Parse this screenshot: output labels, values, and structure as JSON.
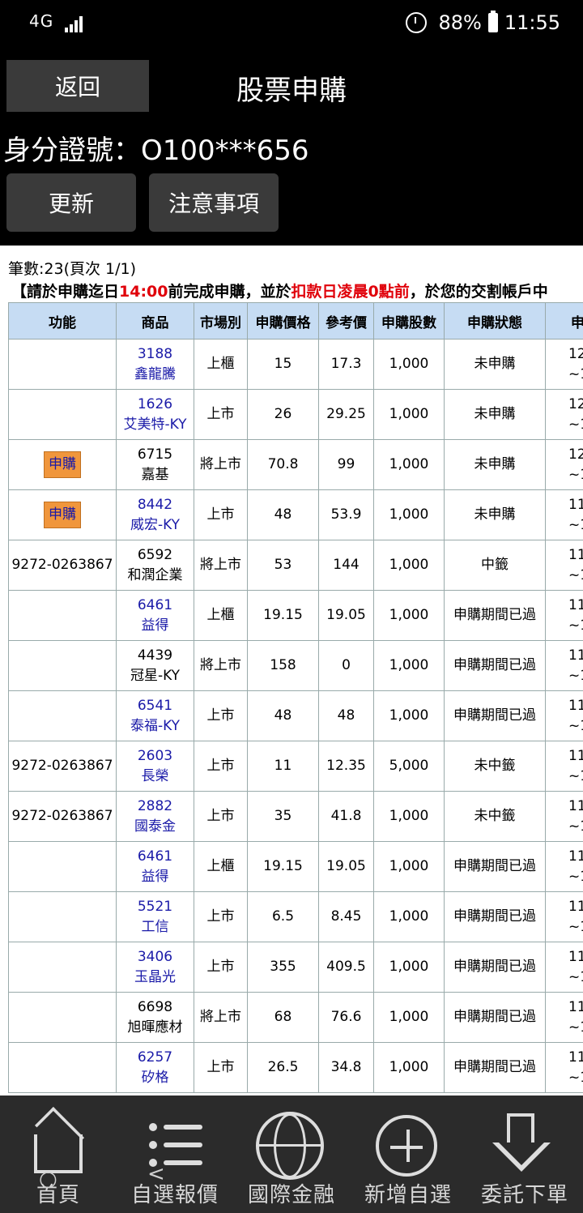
{
  "status_bar": {
    "network": "4G",
    "battery": "88%",
    "time": "11:55"
  },
  "header": {
    "back_label": "返回",
    "title": "股票申購"
  },
  "id_line": "身分證號：O100***656",
  "buttons": {
    "refresh": "更新",
    "notice": "注意事項"
  },
  "count_text": "筆數:23(頁次 1/1)",
  "notice": {
    "p1": "【請於申購迄日",
    "p2": "14:00",
    "p3": "前完成申購，並於",
    "p4": "扣款日凌晨0點前",
    "p5": "，於您的交割帳戶中"
  },
  "colors": {
    "notice_red": "#e0000a",
    "header_blue": "#c6dcf3",
    "apply_orange": "#f0963c"
  },
  "table": {
    "headers": [
      "功能",
      "商品",
      "市場別",
      "申購價格",
      "參考價",
      "申購股數",
      "申購狀態",
      "申購"
    ],
    "rows": [
      {
        "func": "",
        "code": "3188",
        "name": "鑫龍騰",
        "link": true,
        "market": "上櫃",
        "price": "15",
        "ref": "17.3",
        "shares": "1,000",
        "status": "未申購",
        "d1": "12",
        "d2": "~1"
      },
      {
        "func": "",
        "code": "1626",
        "name": "艾美特-KY",
        "link": true,
        "market": "上市",
        "price": "26",
        "ref": "29.25",
        "shares": "1,000",
        "status": "未申購",
        "d1": "12",
        "d2": "~1"
      },
      {
        "func": "申購",
        "code": "6715",
        "name": "嘉基",
        "link": false,
        "market": "將上市",
        "price": "70.8",
        "ref": "99",
        "shares": "1,000",
        "status": "未申購",
        "d1": "12",
        "d2": "~1"
      },
      {
        "func": "申購",
        "code": "8442",
        "name": "威宏-KY",
        "link": true,
        "market": "上市",
        "price": "48",
        "ref": "53.9",
        "shares": "1,000",
        "status": "未申購",
        "d1": "11",
        "d2": "~1"
      },
      {
        "func": "9272-0263867",
        "code": "6592",
        "name": "和潤企業",
        "link": false,
        "market": "將上市",
        "price": "53",
        "ref": "144",
        "shares": "1,000",
        "status": "中籤",
        "d1": "11",
        "d2": "~1"
      },
      {
        "func": "",
        "code": "6461",
        "name": "益得",
        "link": true,
        "market": "上櫃",
        "price": "19.15",
        "ref": "19.05",
        "shares": "1,000",
        "status": "申購期間已過",
        "d1": "11",
        "d2": "~1"
      },
      {
        "func": "",
        "code": "4439",
        "name": "冠星-KY",
        "link": false,
        "market": "將上市",
        "price": "158",
        "ref": "0",
        "shares": "1,000",
        "status": "申購期間已過",
        "d1": "11",
        "d2": "~1"
      },
      {
        "func": "",
        "code": "6541",
        "name": "泰福-KY",
        "link": true,
        "market": "上市",
        "price": "48",
        "ref": "48",
        "shares": "1,000",
        "status": "申購期間已過",
        "d1": "11",
        "d2": "~1"
      },
      {
        "func": "9272-0263867",
        "code": "2603",
        "name": "長榮",
        "link": true,
        "market": "上市",
        "price": "11",
        "ref": "12.35",
        "shares": "5,000",
        "status": "未中籤",
        "d1": "11",
        "d2": "~1"
      },
      {
        "func": "9272-0263867",
        "code": "2882",
        "name": "國泰金",
        "link": true,
        "market": "上市",
        "price": "35",
        "ref": "41.8",
        "shares": "1,000",
        "status": "未中籤",
        "d1": "11",
        "d2": "~1"
      },
      {
        "func": "",
        "code": "6461",
        "name": "益得",
        "link": true,
        "market": "上櫃",
        "price": "19.15",
        "ref": "19.05",
        "shares": "1,000",
        "status": "申購期間已過",
        "d1": "11",
        "d2": "~1"
      },
      {
        "func": "",
        "code": "5521",
        "name": "工信",
        "link": true,
        "market": "上市",
        "price": "6.5",
        "ref": "8.45",
        "shares": "1,000",
        "status": "申購期間已過",
        "d1": "11",
        "d2": "~1"
      },
      {
        "func": "",
        "code": "3406",
        "name": "玉晶光",
        "link": true,
        "market": "上市",
        "price": "355",
        "ref": "409.5",
        "shares": "1,000",
        "status": "申購期間已過",
        "d1": "11",
        "d2": "~1"
      },
      {
        "func": "",
        "code": "6698",
        "name": "旭暉應材",
        "link": false,
        "market": "將上市",
        "price": "68",
        "ref": "76.6",
        "shares": "1,000",
        "status": "申購期間已過",
        "d1": "11",
        "d2": "~1"
      },
      {
        "func": "",
        "code": "6257",
        "name": "矽格",
        "link": true,
        "market": "上市",
        "price": "26.5",
        "ref": "34.8",
        "shares": "1,000",
        "status": "申購期間已過",
        "d1": "11",
        "d2": "~1"
      }
    ]
  },
  "bottom_nav": [
    {
      "label": "首頁",
      "icon": "home-icon"
    },
    {
      "label": "自選報價",
      "icon": "list-icon"
    },
    {
      "label": "國際金融",
      "icon": "globe-icon"
    },
    {
      "label": "新增自選",
      "icon": "plus-icon"
    },
    {
      "label": "委託下單",
      "icon": "arrow-down-icon"
    }
  ]
}
